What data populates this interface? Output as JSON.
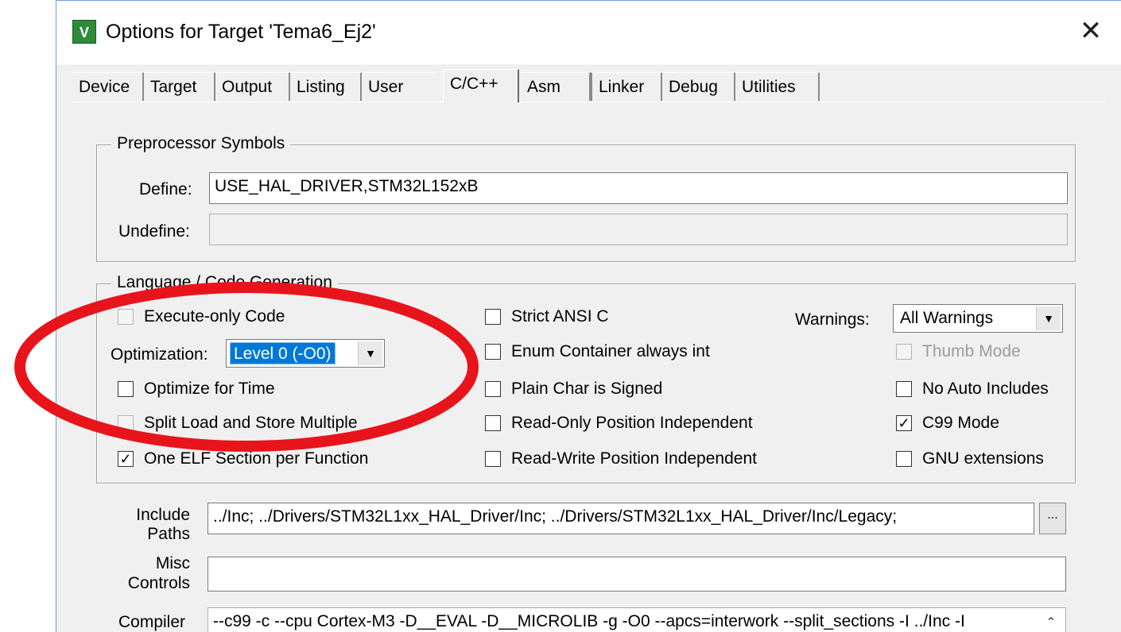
{
  "window": {
    "title": "Options for Target 'Tema6_Ej2'",
    "close_glyph": "✕",
    "app_icon": "keil-uvision-icon"
  },
  "tabs": [
    {
      "label": "Device"
    },
    {
      "label": "Target"
    },
    {
      "label": "Output"
    },
    {
      "label": "Listing"
    },
    {
      "label": "User"
    },
    {
      "label": "C/C++"
    },
    {
      "label": "Asm"
    },
    {
      "label": "Linker"
    },
    {
      "label": "Debug"
    },
    {
      "label": "Utilities"
    }
  ],
  "active_tab": "C/C++",
  "preprocessor": {
    "group_label": "Preprocessor Symbols",
    "define_label": "Define:",
    "define_value": "USE_HAL_DRIVER,STM32L152xB",
    "undefine_label": "Undefine:",
    "undefine_value": ""
  },
  "language": {
    "group_label": "Language / Code Generation",
    "execute_only": {
      "label": "Execute-only Code",
      "checked": false,
      "enabled": false
    },
    "optimization_label": "Optimization:",
    "optimization_value": "Level 0 (-O0)",
    "optimize_time": {
      "label": "Optimize for Time",
      "checked": false
    },
    "split_load": {
      "label": "Split Load and Store Multiple",
      "checked": false,
      "enabled": false
    },
    "one_elf": {
      "label": "One ELF Section per Function",
      "checked": true
    },
    "strict_ansi": {
      "label": "Strict ANSI C",
      "checked": false
    },
    "enum_container": {
      "label": "Enum Container always int",
      "checked": false
    },
    "plain_char": {
      "label": "Plain Char is Signed",
      "checked": false
    },
    "ro_pi": {
      "label": "Read-Only Position Independent",
      "checked": false
    },
    "rw_pi": {
      "label": "Read-Write Position Independent",
      "checked": false
    },
    "warnings_label": "Warnings:",
    "warnings_value": "All Warnings",
    "thumb_mode": {
      "label": "Thumb Mode",
      "checked": false,
      "enabled": false
    },
    "no_auto_includes": {
      "label": "No Auto Includes",
      "checked": false
    },
    "c99_mode": {
      "label": "C99 Mode",
      "checked": true
    },
    "gnu_ext": {
      "label": "GNU extensions",
      "checked": false
    }
  },
  "include": {
    "label_line1": "Include",
    "label_line2": "Paths",
    "value": "../Inc;  ../Drivers/STM32L1xx_HAL_Driver/Inc;  ../Drivers/STM32L1xx_HAL_Driver/Inc/Legacy;",
    "browse_label": "..."
  },
  "misc": {
    "label_line1": "Misc",
    "label_line2": "Controls",
    "value": ""
  },
  "compiler": {
    "label": "Compiler",
    "value": "--c99 -c --cpu Cortex-M3 -D__EVAL -D__MICROLIB -g -O0 --apcs=interwork --split_sections -I ../Inc -I"
  },
  "annotation": {
    "shape": "ellipse",
    "color": "#e8141b"
  }
}
